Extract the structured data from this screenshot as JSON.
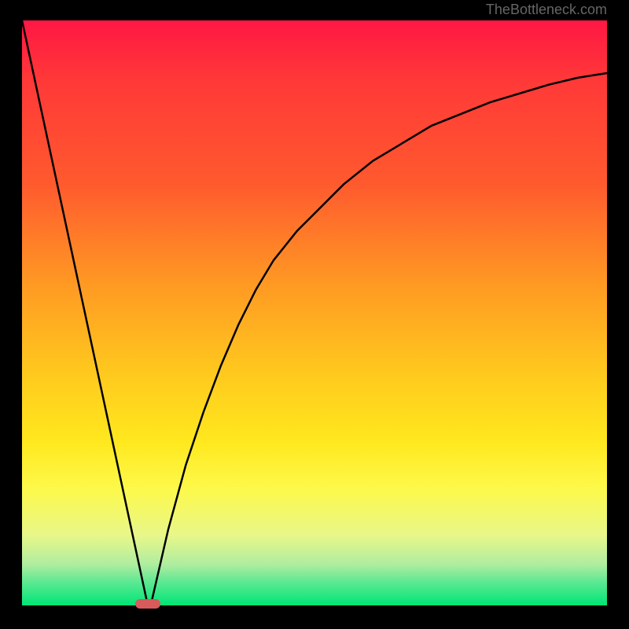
{
  "watermark": "TheBottleneck.com",
  "chart_data": {
    "type": "line",
    "title": "",
    "xlabel": "",
    "ylabel": "",
    "xlim": [
      0,
      100
    ],
    "ylim": [
      0,
      100
    ],
    "series": [
      {
        "name": "left-line",
        "x": [
          0,
          21.5
        ],
        "y": [
          100,
          0
        ]
      },
      {
        "name": "right-curve",
        "x": [
          22,
          25,
          28,
          31,
          34,
          37,
          40,
          43,
          47,
          51,
          55,
          60,
          65,
          70,
          75,
          80,
          85,
          90,
          95,
          100
        ],
        "y": [
          0,
          13,
          24,
          33,
          41,
          48,
          54,
          59,
          64,
          68,
          72,
          76,
          79,
          82,
          84,
          86,
          87.5,
          89,
          90.2,
          91
        ]
      }
    ],
    "marker": {
      "x": 21.5,
      "y": 0,
      "color": "#d85a5a"
    },
    "background_gradient": {
      "top": "#ff1744",
      "bottom": "#00e676"
    }
  }
}
